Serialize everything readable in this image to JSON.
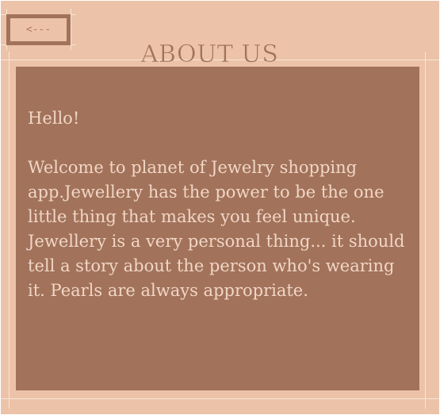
{
  "header": {
    "back_label": "<---",
    "title": "ABOUT US"
  },
  "about": {
    "greeting": "Hello!",
    "paragraph1": "Welcome to planet of Jewelry shopping app.Jewellery has the power to be the one little thing that makes you feel unique.",
    "paragraph2": "Jewellery is a very personal thing... it should tell a story about the person who's wearing it. Pearls are always appropriate."
  },
  "colors": {
    "background": "#ecc3a8",
    "panel": "#a2725a",
    "panel_text": "#f1d6c6",
    "frame_lines": "#f7e4d6"
  }
}
